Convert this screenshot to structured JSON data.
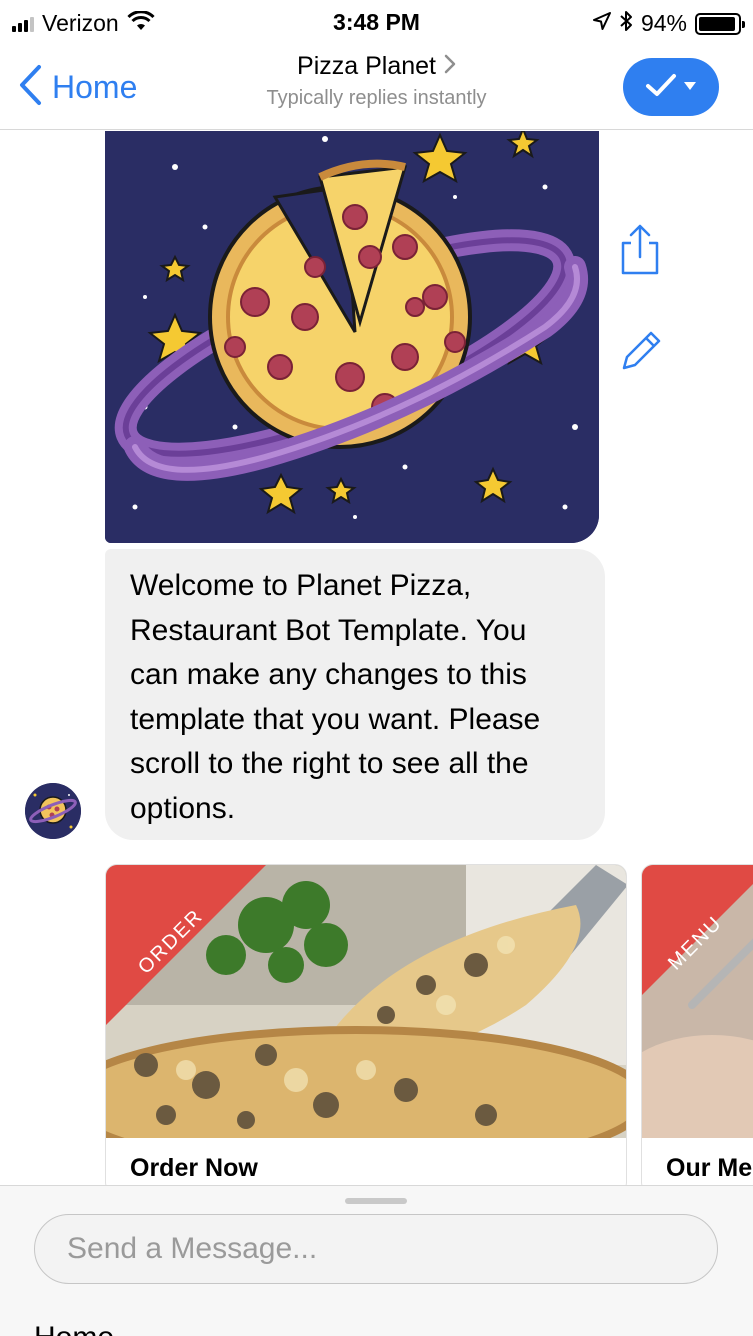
{
  "status_bar": {
    "carrier": "Verizon",
    "time": "3:48 PM",
    "battery_percent": "94%",
    "battery_level": 0.94,
    "signal_bars": 3
  },
  "nav": {
    "back_label": "Home",
    "title": "Pizza Planet",
    "subtitle": "Typically replies instantly",
    "accent_color": "#2f7ff0"
  },
  "chat": {
    "welcome_message": "Welcome to Planet Pizza, Restaurant Bot Template. You can make any changes to this template that you want. Please scroll to the right to see all the options.",
    "cards": [
      {
        "ribbon": "ORDER",
        "title": "Order Now"
      },
      {
        "ribbon": "MENU",
        "title": "Our Me"
      }
    ]
  },
  "composer": {
    "placeholder": "Send a Message...",
    "menu_label": "Home"
  },
  "icons": [
    "signal-icon",
    "wifi-icon",
    "location-arrow-icon",
    "bluetooth-icon",
    "battery-icon",
    "chevron-left-icon",
    "chevron-right-icon",
    "checkmark-icon",
    "caret-down-icon",
    "share-icon",
    "pencil-icon"
  ]
}
